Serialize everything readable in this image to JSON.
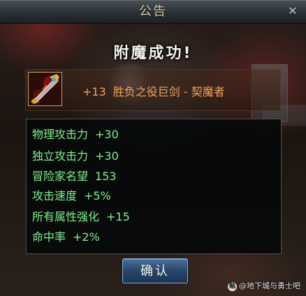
{
  "dialog": {
    "title": "公告",
    "close_icon": "close-icon"
  },
  "heading": "附魔成功!",
  "item": {
    "upgrade": "+13",
    "name": "胜负之役巨剑 - 契魔者",
    "icon": "greatsword-icon",
    "name_color": "#f0a35a"
  },
  "stats": [
    {
      "label": "物理攻击力",
      "value": "+30"
    },
    {
      "label": "独立攻击力",
      "value": "+30"
    },
    {
      "label": "冒险家名望",
      "value": "153"
    },
    {
      "label": "攻击速度",
      "value": "+5%"
    },
    {
      "label": "所有属性强化",
      "value": "+15"
    },
    {
      "label": "命中率",
      "value": "+2%"
    }
  ],
  "stat_color": "#7ef08e",
  "confirm_label": "确认",
  "watermark": {
    "text": "@地下城与勇士吧",
    "logo": "tieba-logo-icon"
  }
}
